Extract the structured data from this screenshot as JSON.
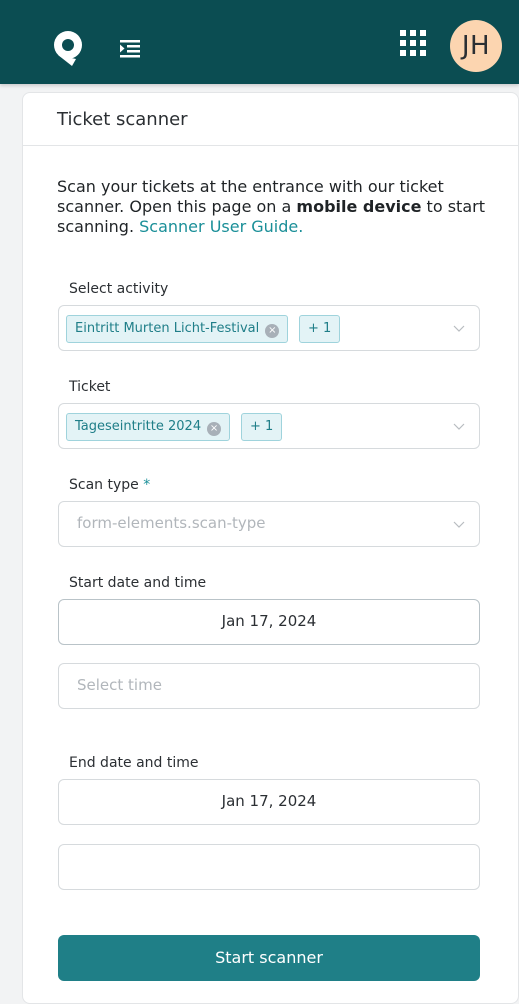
{
  "header": {
    "user_initials": "JH",
    "colors": {
      "bar": "#0b4d52",
      "avatar": "#fcd5b0",
      "accent": "#1a8f98"
    },
    "icons": [
      "logo-icon",
      "nav-toggle-icon",
      "apps-grid-icon"
    ]
  },
  "card": {
    "title": "Ticket scanner",
    "intro": {
      "part1": "Scan your tickets at the entrance with our ticket scanner. Open this page on a ",
      "bold": "mobile device",
      "part2": " to start scanning. ",
      "link": "Scanner User Guide."
    }
  },
  "form": {
    "activity": {
      "label": "Select activity",
      "chip": "Eintritt Murten Licht-Festival",
      "more": "+ 1"
    },
    "ticket": {
      "label": "Ticket",
      "chip": "Tageseintritte 2024",
      "more": "+ 1"
    },
    "scan_type": {
      "label": "Scan type",
      "required_mark": "*",
      "placeholder": "form-elements.scan-type"
    },
    "start": {
      "label": "Start date and time",
      "date": "Jan 17, 2024",
      "time_placeholder": "Select time"
    },
    "end": {
      "label": "End date and time",
      "date": "Jan 17, 2024",
      "time_value": ""
    },
    "submit": "Start scanner"
  }
}
